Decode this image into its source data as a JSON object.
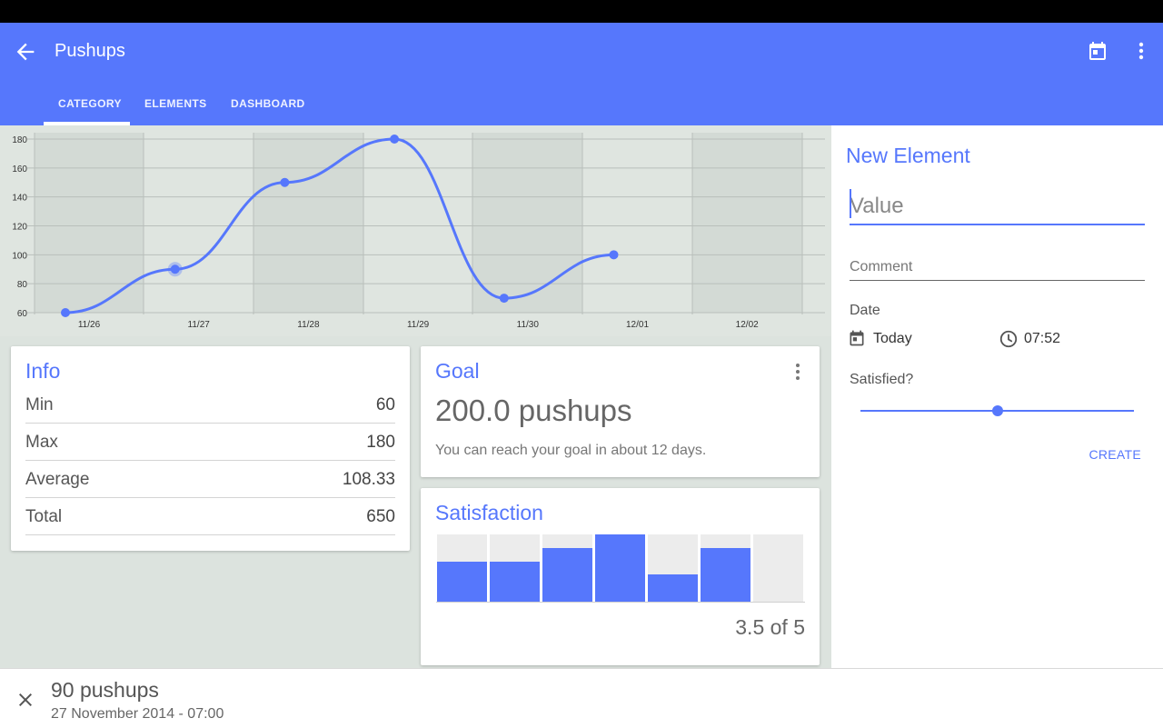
{
  "app": {
    "title": "Pushups",
    "icons": {
      "back": "arrow-back-icon",
      "calendar": "calendar-icon",
      "more": "more-vert-icon"
    }
  },
  "tabs": [
    {
      "label": "CATEGORY",
      "active": true
    },
    {
      "label": "ELEMENTS",
      "active": false
    },
    {
      "label": "DASHBOARD",
      "active": false
    }
  ],
  "chart_data": {
    "type": "line",
    "categories": [
      "11/26",
      "11/27",
      "11/28",
      "11/29",
      "11/30",
      "12/01",
      "12/02"
    ],
    "series": [
      {
        "values": [
          60,
          90,
          150,
          180,
          70,
          100,
          null
        ]
      }
    ],
    "highlighted_index": 1,
    "yticks": [
      60,
      80,
      100,
      120,
      140,
      160,
      180
    ],
    "ylim": [
      60,
      180
    ],
    "grid": true,
    "colors": {
      "line": "#5677fc",
      "band": "#d3dad5",
      "background": "#dfe5e0",
      "grid": "#b9bfbb"
    }
  },
  "info": {
    "title": "Info",
    "rows": [
      {
        "label": "Min",
        "value": "60"
      },
      {
        "label": "Max",
        "value": "180"
      },
      {
        "label": "Average",
        "value": "108.33"
      },
      {
        "label": "Total",
        "value": "650"
      }
    ]
  },
  "goal": {
    "title": "Goal",
    "value": "200.0 pushups",
    "hint": "You can reach your goal in about 12 days."
  },
  "satisfaction": {
    "title": "Satisfaction",
    "levels": [
      0.6,
      0.6,
      0.8,
      1.0,
      0.4,
      0.8,
      0.0
    ],
    "score": "3.5 of 5"
  },
  "new_element": {
    "title": "New Element",
    "value_placeholder": "Value",
    "comment_placeholder": "Comment",
    "date_label": "Date",
    "date_value": "Today",
    "time_value": "07:52",
    "satisfied_label": "Satisfied?",
    "satisfied_level": 0.5,
    "create_label": "CREATE"
  },
  "snackbar": {
    "title": "90 pushups",
    "subtitle": "27 November 2014 - 07:00"
  },
  "colors": {
    "primary": "#5677fc",
    "background": "#dce3de"
  }
}
